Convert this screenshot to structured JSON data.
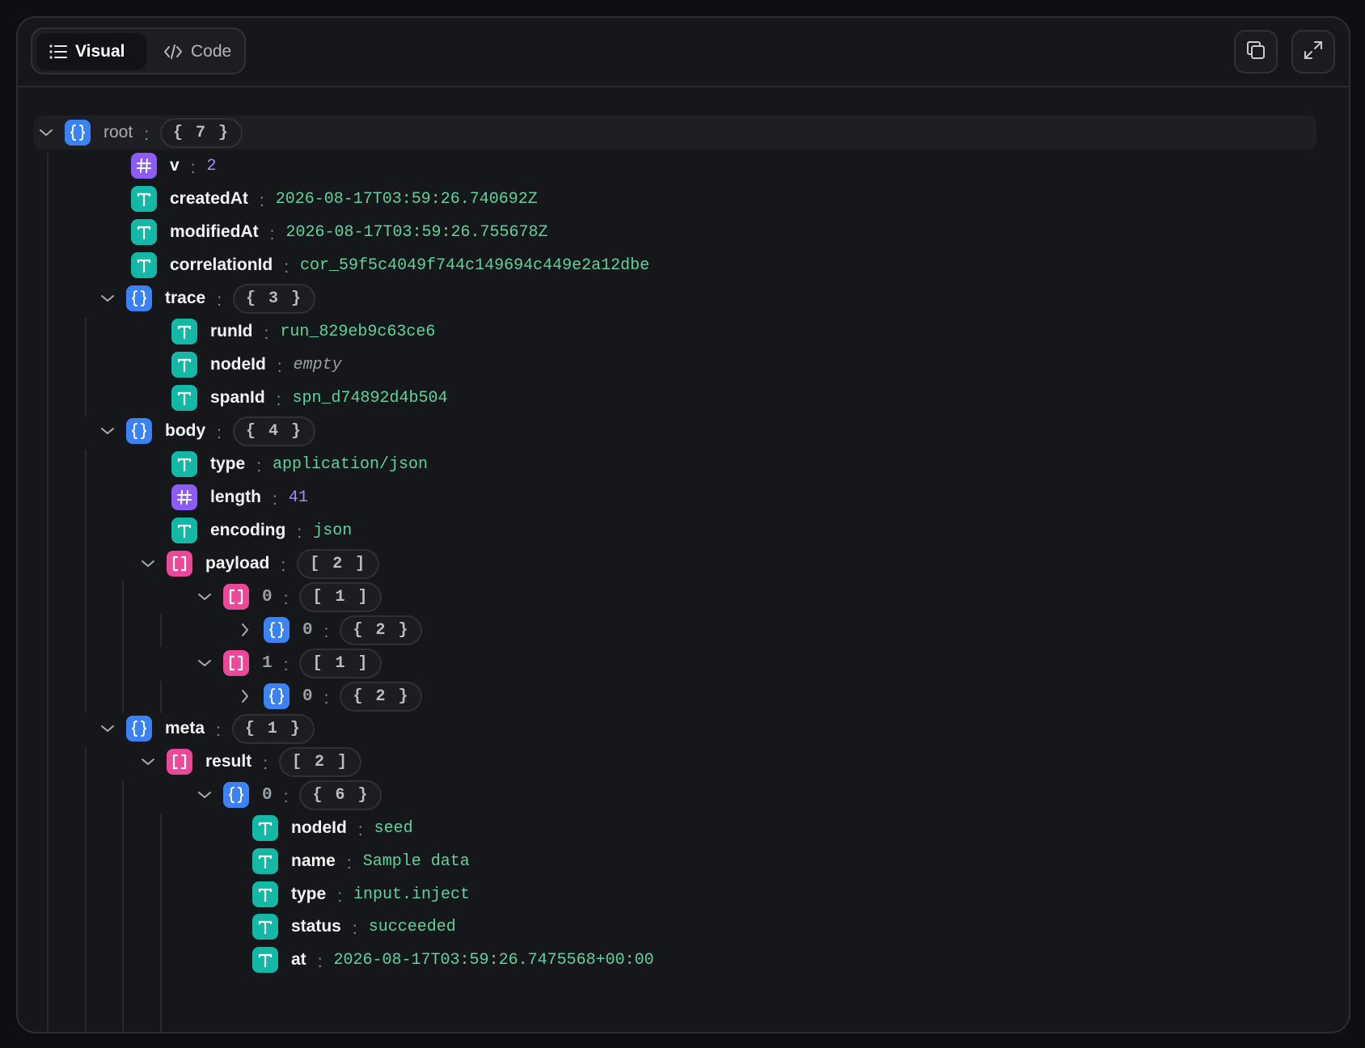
{
  "toolbar": {
    "tabs": [
      {
        "label": "Visual",
        "icon": "list-icon"
      },
      {
        "label": "Code",
        "icon": "code-icon"
      }
    ],
    "copy_icon": "copy-icon",
    "expand_icon": "expand-icon"
  },
  "colors": {
    "object_badge": "#3b82f6",
    "array_badge": "#ec4899",
    "number_badge": "#8b5cf6",
    "string_badge": "#14b8a6",
    "string_value": "#5fd39a",
    "number_value": "#a78bfa"
  },
  "tree": {
    "root": {
      "key": "root",
      "count": "{ 7 }"
    },
    "v": {
      "key": "v",
      "value": "2"
    },
    "createdAt": {
      "key": "createdAt",
      "value": "2026-08-17T03:59:26.740692Z"
    },
    "modifiedAt": {
      "key": "modifiedAt",
      "value": "2026-08-17T03:59:26.755678Z"
    },
    "correlationId": {
      "key": "correlationId",
      "value": "cor_59f5c4049f744c149694c449e2a12dbe"
    },
    "trace": {
      "key": "trace",
      "count": "{ 3 }",
      "runId": {
        "key": "runId",
        "value": "run_829eb9c63ce6"
      },
      "nodeId": {
        "key": "nodeId",
        "value": "empty"
      },
      "spanId": {
        "key": "spanId",
        "value": "spn_d74892d4b504"
      }
    },
    "body": {
      "key": "body",
      "count": "{ 4 }",
      "type": {
        "key": "type",
        "value": "application/json"
      },
      "length": {
        "key": "length",
        "value": "41"
      },
      "encoding": {
        "key": "encoding",
        "value": "json"
      },
      "payload": {
        "key": "payload",
        "count": "[ 2 ]",
        "item0": {
          "key": "0",
          "count": "[ 1 ]",
          "child": {
            "key": "0",
            "count": "{ 2 }"
          }
        },
        "item1": {
          "key": "1",
          "count": "[ 1 ]",
          "child": {
            "key": "0",
            "count": "{ 2 }"
          }
        }
      }
    },
    "meta": {
      "key": "meta",
      "count": "{ 1 }",
      "result": {
        "key": "result",
        "count": "[ 2 ]",
        "item0": {
          "key": "0",
          "count": "{ 6 }",
          "nodeId": {
            "key": "nodeId",
            "value": "seed"
          },
          "name": {
            "key": "name",
            "value": "Sample data"
          },
          "type": {
            "key": "type",
            "value": "input.inject"
          },
          "status": {
            "key": "status",
            "value": "succeeded"
          },
          "at": {
            "key": "at",
            "value": "2026-08-17T03:59:26.7475568+00:00"
          }
        }
      }
    }
  }
}
